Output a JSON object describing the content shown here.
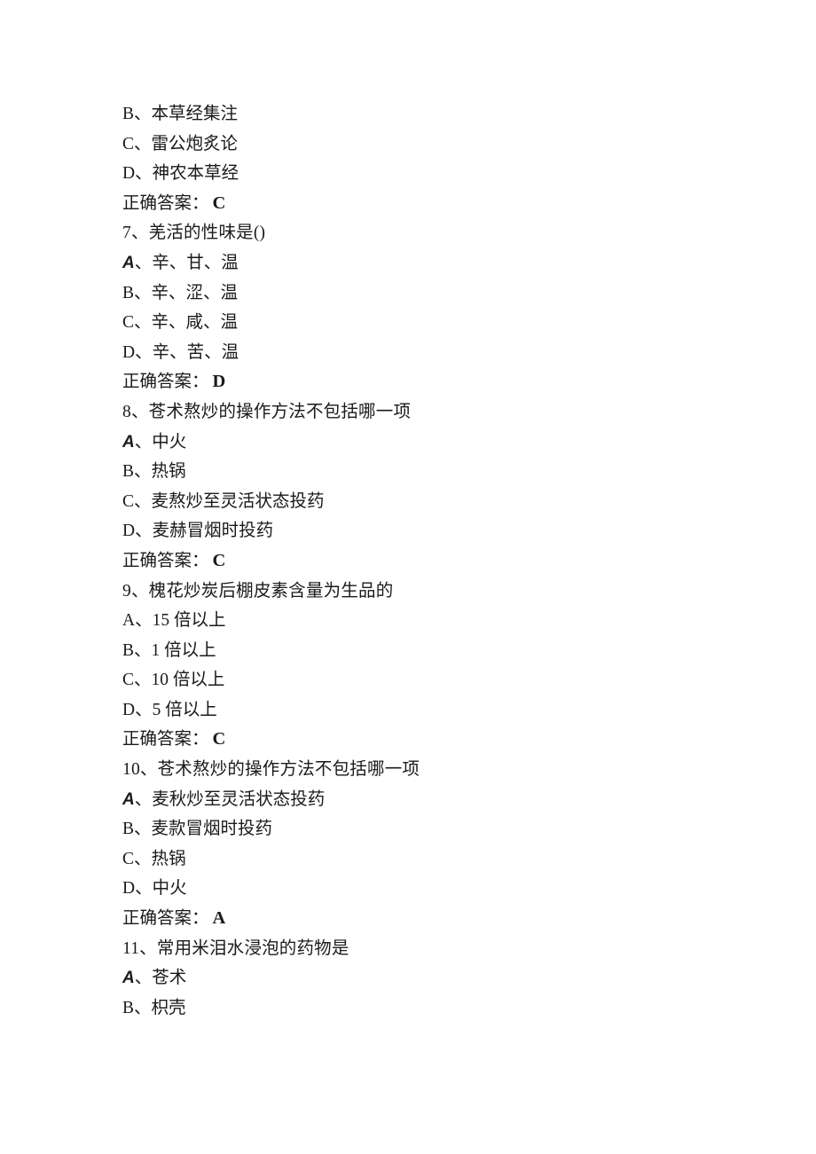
{
  "document": {
    "type": "exam-question-sheet",
    "language": "zh-CN",
    "answer_label": "正确答案：",
    "marker_separator": "、"
  },
  "leading_options": [
    {
      "marker": "B",
      "emphasis": false,
      "text": "本草经集注"
    },
    {
      "marker": "C",
      "emphasis": false,
      "text": "雷公炮炙论"
    },
    {
      "marker": "D",
      "emphasis": false,
      "text": "神农本草经"
    }
  ],
  "leading_answer": "C",
  "questions": [
    {
      "number": "7",
      "stem": "7、羌活的性味是()",
      "options": [
        {
          "marker": "A",
          "emphasis": true,
          "text": "辛、甘、温"
        },
        {
          "marker": "B",
          "emphasis": false,
          "text": "辛、涩、温"
        },
        {
          "marker": "C",
          "emphasis": false,
          "text": "辛、咸、温"
        },
        {
          "marker": "D",
          "emphasis": false,
          "text": "辛、苦、温"
        }
      ],
      "answer": "D"
    },
    {
      "number": "8",
      "stem": "8、苍术熬炒的操作方法不包括哪一项",
      "options": [
        {
          "marker": "A",
          "emphasis": true,
          "text": "中火"
        },
        {
          "marker": "B",
          "emphasis": false,
          "text": "热锅"
        },
        {
          "marker": "C",
          "emphasis": false,
          "text": "麦熬炒至灵活状态投药"
        },
        {
          "marker": "D",
          "emphasis": false,
          "text": "麦赫冒烟时投药"
        }
      ],
      "answer": "C"
    },
    {
      "number": "9",
      "stem": "9、槐花炒炭后棚皮素含量为生品的",
      "options": [
        {
          "marker": "A",
          "emphasis": false,
          "text": "15 倍以上"
        },
        {
          "marker": "B",
          "emphasis": false,
          "text": "1 倍以上"
        },
        {
          "marker": "C",
          "emphasis": false,
          "text": "10 倍以上"
        },
        {
          "marker": "D",
          "emphasis": false,
          "text": "5 倍以上"
        }
      ],
      "answer": "C"
    },
    {
      "number": "10",
      "stem": "10、苍术熬炒的操作方法不包括哪一项",
      "options": [
        {
          "marker": "A",
          "emphasis": true,
          "text": "麦秋炒至灵活状态投药"
        },
        {
          "marker": "B",
          "emphasis": false,
          "text": "麦款冒烟时投药"
        },
        {
          "marker": "C",
          "emphasis": false,
          "text": "热锅"
        },
        {
          "marker": "D",
          "emphasis": false,
          "text": "中火"
        }
      ],
      "answer": "A"
    },
    {
      "number": "11",
      "stem": "11、常用米泪水浸泡的药物是",
      "options": [
        {
          "marker": "A",
          "emphasis": true,
          "text": "苍术"
        },
        {
          "marker": "B",
          "emphasis": false,
          "text": "枳壳"
        }
      ],
      "answer": null
    }
  ]
}
